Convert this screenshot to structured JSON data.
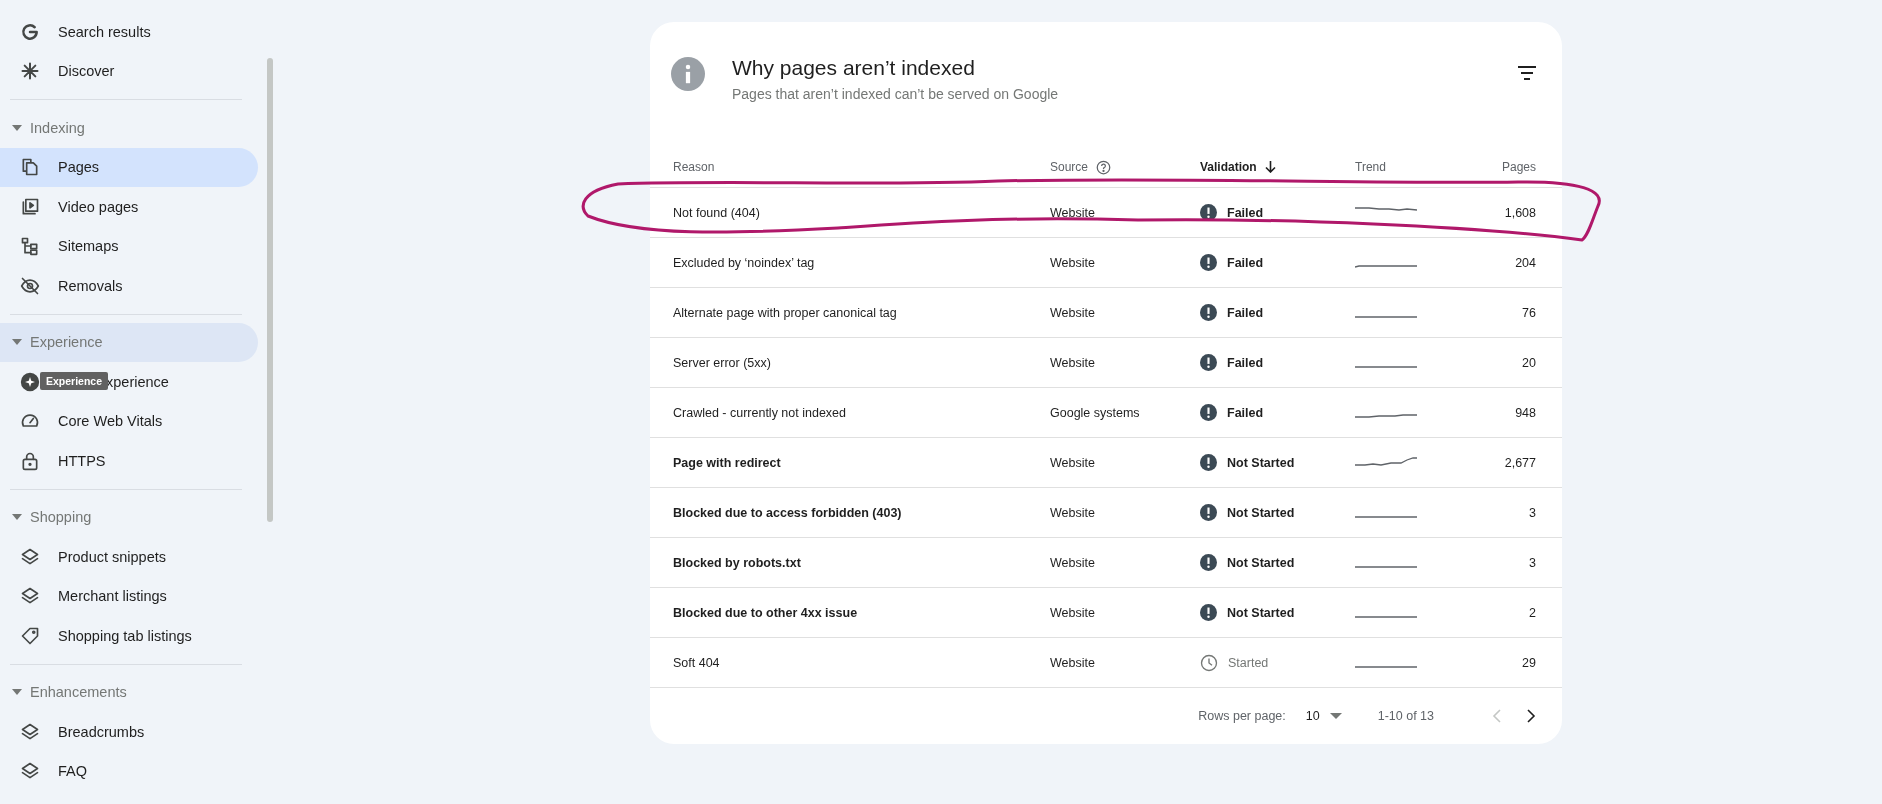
{
  "sidebar": {
    "items": [
      {
        "label": "Search results",
        "selected": false
      },
      {
        "label": "Discover",
        "selected": false
      }
    ],
    "sections": [
      {
        "title": "Indexing",
        "expanded": true,
        "hovered": false,
        "items": [
          {
            "label": "Pages",
            "selected": true
          },
          {
            "label": "Video pages",
            "selected": false
          },
          {
            "label": "Sitemaps",
            "selected": false
          },
          {
            "label": "Removals",
            "selected": false
          }
        ]
      },
      {
        "title": "Experience",
        "expanded": true,
        "hovered": true,
        "items": [
          {
            "label": "xperience",
            "selected": false,
            "tooltip": "Experience"
          },
          {
            "label": "Core Web Vitals",
            "selected": false
          },
          {
            "label": "HTTPS",
            "selected": false
          }
        ]
      },
      {
        "title": "Shopping",
        "expanded": true,
        "hovered": false,
        "items": [
          {
            "label": "Product snippets",
            "selected": false
          },
          {
            "label": "Merchant listings",
            "selected": false
          },
          {
            "label": "Shopping tab listings",
            "selected": false
          }
        ]
      },
      {
        "title": "Enhancements",
        "expanded": true,
        "hovered": false,
        "items": [
          {
            "label": "Breadcrumbs",
            "selected": false
          },
          {
            "label": "FAQ",
            "selected": false
          }
        ]
      }
    ]
  },
  "card": {
    "title": "Why pages aren’t indexed",
    "subtitle": "Pages that aren’t indexed can’t be served on Google",
    "table": {
      "columns": [
        {
          "label": "Reason",
          "sorted": false,
          "help": false
        },
        {
          "label": "Source",
          "sorted": false,
          "help": true
        },
        {
          "label": "Validation",
          "sorted": true,
          "help": false
        },
        {
          "label": "Trend",
          "sorted": false,
          "help": false
        },
        {
          "label": "Pages",
          "sorted": false,
          "help": false
        }
      ],
      "rows": [
        {
          "reason": "Not found (404)",
          "bold": false,
          "source": "Website",
          "in_progress": false,
          "validation": "Failed",
          "pages": "1,608"
        },
        {
          "reason": "Excluded by ‘noindex’ tag",
          "bold": false,
          "source": "Website",
          "in_progress": false,
          "validation": "Failed",
          "pages": "204"
        },
        {
          "reason": "Alternate page with proper canonical tag",
          "bold": false,
          "source": "Website",
          "in_progress": false,
          "validation": "Failed",
          "pages": "76"
        },
        {
          "reason": "Server error (5xx)",
          "bold": false,
          "source": "Website",
          "in_progress": false,
          "validation": "Failed",
          "pages": "20"
        },
        {
          "reason": "Crawled - currently not indexed",
          "bold": false,
          "source": "Google systems",
          "in_progress": false,
          "validation": "Failed",
          "pages": "948"
        },
        {
          "reason": "Page with redirect",
          "bold": true,
          "source": "Website",
          "in_progress": false,
          "validation": "Not Started",
          "pages": "2,677"
        },
        {
          "reason": "Blocked due to access forbidden (403)",
          "bold": true,
          "source": "Website",
          "in_progress": false,
          "validation": "Not Started",
          "pages": "3"
        },
        {
          "reason": "Blocked by robots.txt",
          "bold": true,
          "source": "Website",
          "in_progress": false,
          "validation": "Not Started",
          "pages": "3"
        },
        {
          "reason": "Blocked due to other 4xx issue",
          "bold": true,
          "source": "Website",
          "in_progress": false,
          "validation": "Not Started",
          "pages": "2"
        },
        {
          "reason": "Soft 404",
          "bold": false,
          "source": "Website",
          "in_progress": true,
          "validation": "Started",
          "pages": "29"
        }
      ]
    },
    "pagination": {
      "rows_label": "Rows per page:",
      "rows_value": "10",
      "range": "1-10 of 13",
      "prev_disabled": true,
      "next_disabled": false
    }
  }
}
